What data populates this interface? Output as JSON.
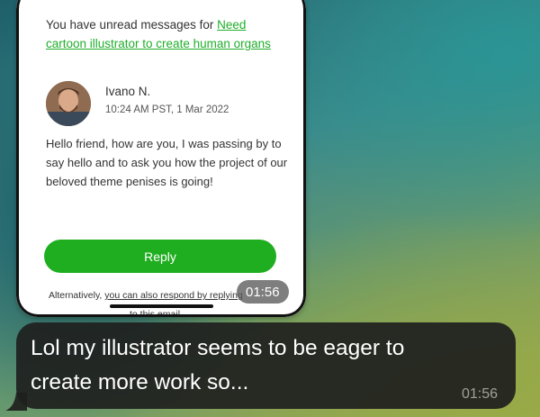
{
  "email": {
    "intro_text": "You have unread messages for ",
    "intro_link": "Need cartoon illustrator to create human organs",
    "sender_name": "Ivano N.",
    "sender_time": "10:24 AM PST, 1 Mar 2022",
    "body": "Hello friend, how are you, I was passing by to say hello and to ask you how the project of our beloved theme penises is going!",
    "reply_label": "Reply",
    "alt_prefix": "Alternatively, ",
    "alt_link": "you can also respond by replying",
    "alt_suffix": "to this email"
  },
  "image_message": {
    "time": "01:56"
  },
  "text_message": {
    "text": "Lol my illustrator seems to be eager to create more work so...",
    "time": "01:56"
  },
  "colors": {
    "accent_green": "#1fae1f",
    "bubble_dark": "#1e201e"
  }
}
